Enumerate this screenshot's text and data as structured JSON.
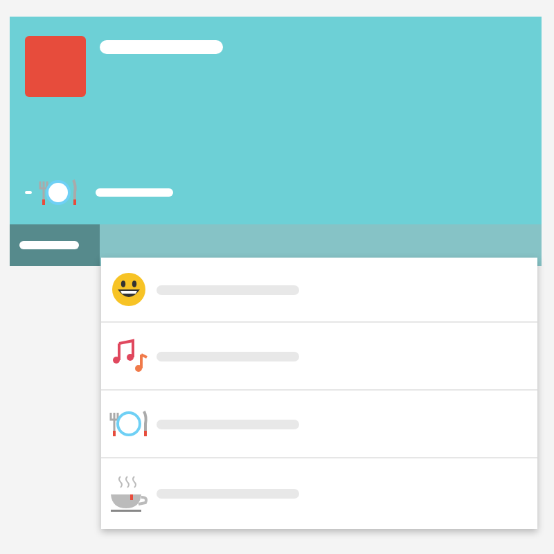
{
  "header": {
    "category": {
      "kind": "dining"
    }
  },
  "tabs": [
    {
      "selected": true
    }
  ],
  "items": [
    {
      "kind": "smiley"
    },
    {
      "kind": "music"
    },
    {
      "kind": "dining"
    },
    {
      "kind": "tea"
    }
  ]
}
